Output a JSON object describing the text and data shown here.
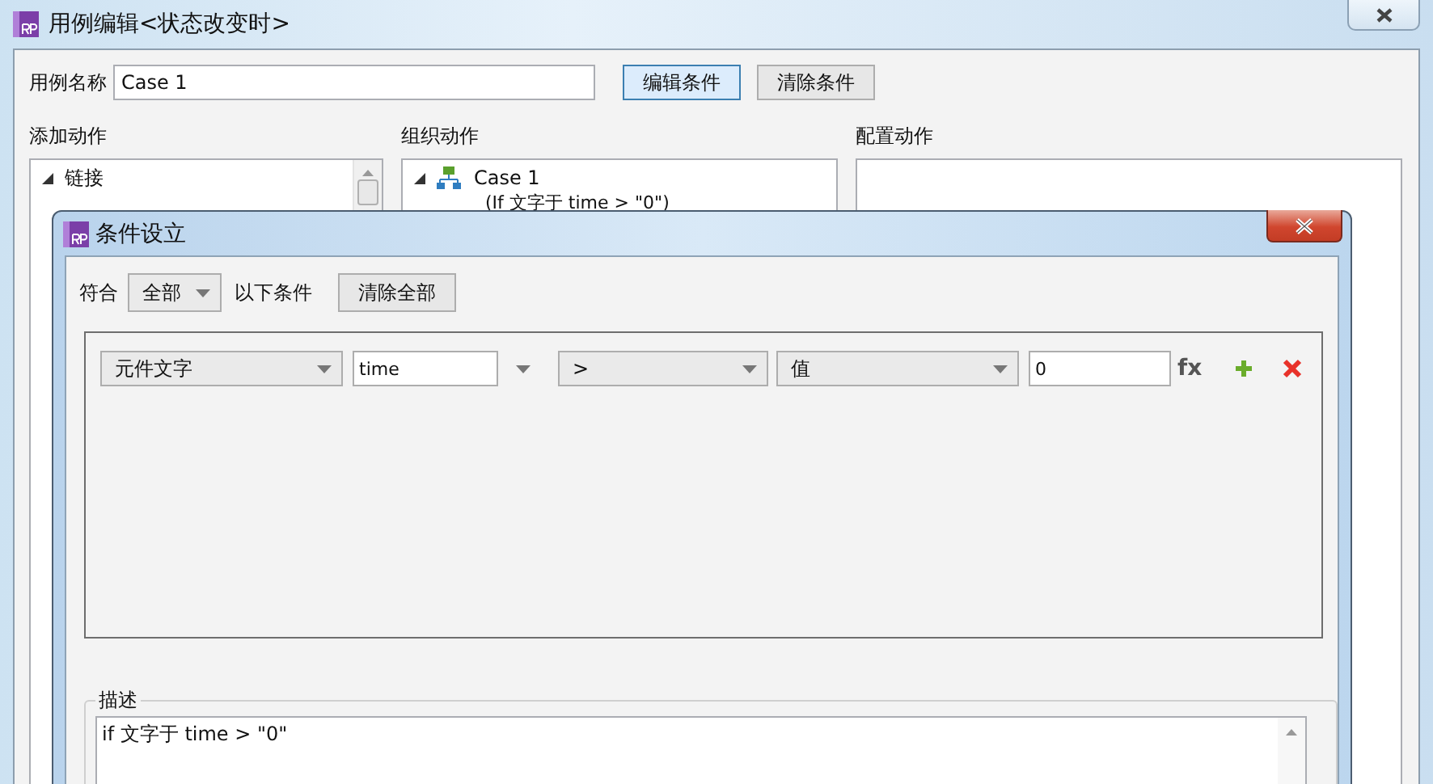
{
  "window": {
    "title": "用例编辑<状态改变时>"
  },
  "case_name": {
    "label": "用例名称",
    "value": "Case 1"
  },
  "buttons": [
    {
      "label": "编辑条件",
      "highlighted": true
    },
    {
      "label": "清除条件",
      "highlighted": false
    }
  ],
  "sections": [
    {
      "label": "添加动作"
    },
    {
      "label": "组织动作"
    },
    {
      "label": "配置动作"
    }
  ],
  "add_actions": [
    {
      "label": "链接",
      "expanded": true
    }
  ],
  "organize_actions": [
    {
      "label": "Case 1",
      "condition": "(If 文字于 time > \"0\")",
      "expanded": true
    }
  ],
  "condition_dialog": {
    "title": "条件设立",
    "match_label": "符合",
    "match_value": "全部",
    "match_suffix": "以下条件",
    "clear_button": "清除全部",
    "conditions": [
      {
        "target": "元件文字",
        "widget": "time",
        "operator": ">",
        "value_type": "值",
        "value": "0",
        "fx": "fx"
      }
    ],
    "description": {
      "label": "描述",
      "text": "if 文字于 time > \"0\""
    }
  }
}
